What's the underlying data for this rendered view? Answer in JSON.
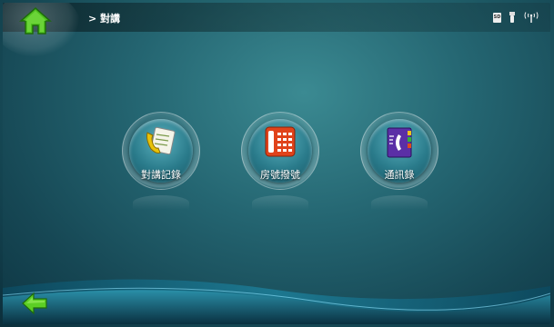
{
  "header": {
    "breadcrumb": "> 對講",
    "home_icon": "home-icon",
    "status_icons": [
      "sd-card-icon",
      "usb-icon",
      "antenna-icon"
    ],
    "sd_label": "SD"
  },
  "apps": [
    {
      "label": "對講記錄",
      "icon": "intercom-log-icon",
      "accent": "#e8c20a"
    },
    {
      "label": "房號撥號",
      "icon": "room-dial-icon",
      "accent": "#e0431b"
    },
    {
      "label": "通訊錄",
      "icon": "address-book-icon",
      "accent": "#5b2fa6"
    }
  ],
  "footer": {
    "back_icon": "back-arrow-icon"
  },
  "colors": {
    "accent_green": "#3fb11c",
    "background": "#246571"
  }
}
